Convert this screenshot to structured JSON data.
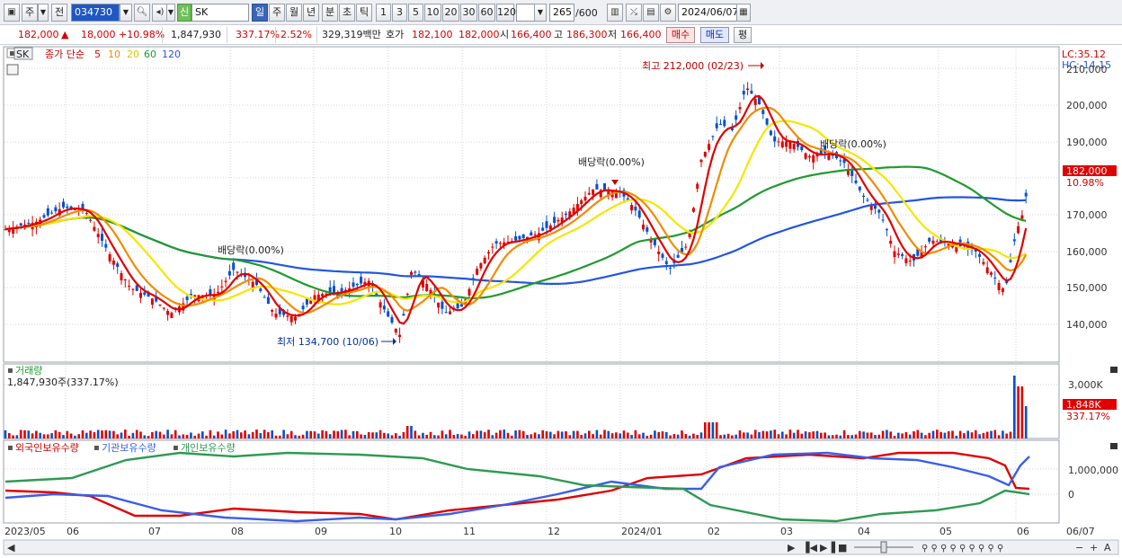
{
  "toolbar": {
    "period_main": "주",
    "prev_label": "전",
    "stock_code": "034730",
    "new_badge": "신",
    "stock_name": "SK",
    "periods": [
      "일",
      "주",
      "월",
      "년",
      "분",
      "초",
      "틱"
    ],
    "active_period": "일",
    "intervals": [
      "1",
      "3",
      "5",
      "10",
      "20",
      "30",
      "60",
      "120"
    ],
    "count_value": "265",
    "count_total": "/600",
    "date_value": "2024/06/07"
  },
  "infobar": {
    "price": "182,000",
    "change_arrow": "▲",
    "change": "18,000",
    "change_pct": "+10.98%",
    "volume": "1,847,930",
    "vol_ratio": "337.17%",
    "turnover": "2.52%",
    "amount": "329,319백만",
    "hoga_label": "호가",
    "hoga_ask": "182,100",
    "hoga_bid": "182,000",
    "open_label": "시",
    "open": "166,400",
    "high_label": "고",
    "high": "186,300",
    "low_label": "저",
    "low": "166,400",
    "buy_label": "매수",
    "sell_label": "매도",
    "flat_label": "평"
  },
  "price_panel": {
    "title_code": "SK",
    "ma_label": "종가 단순",
    "ma_periods": [
      "5",
      "10",
      "20",
      "60",
      "120"
    ],
    "lc_label": "LC:35.12",
    "hc_label": "HC:-14.15",
    "high_annotation": "최고 212,000 (02/23)",
    "low_annotation": "최저 134,700 (10/06)",
    "dividend_label_1": "배당락(0.00%)",
    "dividend_label_2": "배당락(0.00%)",
    "dividend_label_3": "배당락(0.00%)",
    "y_ticks": [
      "210,000",
      "200,000",
      "190,000",
      "180,000",
      "170,000",
      "160,000",
      "150,000",
      "140,000"
    ],
    "current_price_tag": "182,000",
    "current_pct_tag": "10.98%"
  },
  "volume_panel": {
    "title": "거래량",
    "value_text": "1,847,930주(337.17%)",
    "y_tick": "3,000K",
    "current_tag": "1,848K",
    "current_pct": "337.17%"
  },
  "holdings_panel": {
    "legend": [
      "외국인보유수량",
      "기관보유수량",
      "개인보유수량"
    ],
    "y_ticks": [
      "1,000,000",
      "0"
    ]
  },
  "x_axis": {
    "labels": [
      "2023/05",
      "06",
      "07",
      "08",
      "09",
      "10",
      "11",
      "12",
      "2024/01",
      "02",
      "03",
      "04",
      "05",
      "06",
      "06/07"
    ]
  },
  "colors": {
    "candle_up": "#e00000",
    "candle_down": "#0050d0",
    "ma5": "#e00000",
    "ma10": "#f08c00",
    "ma20": "#f5e600",
    "ma60": "#1f9a2e",
    "ma120": "#2255e0",
    "foreign": "#e00000",
    "institution": "#3a5ee8",
    "individual": "#2e9a52"
  }
}
